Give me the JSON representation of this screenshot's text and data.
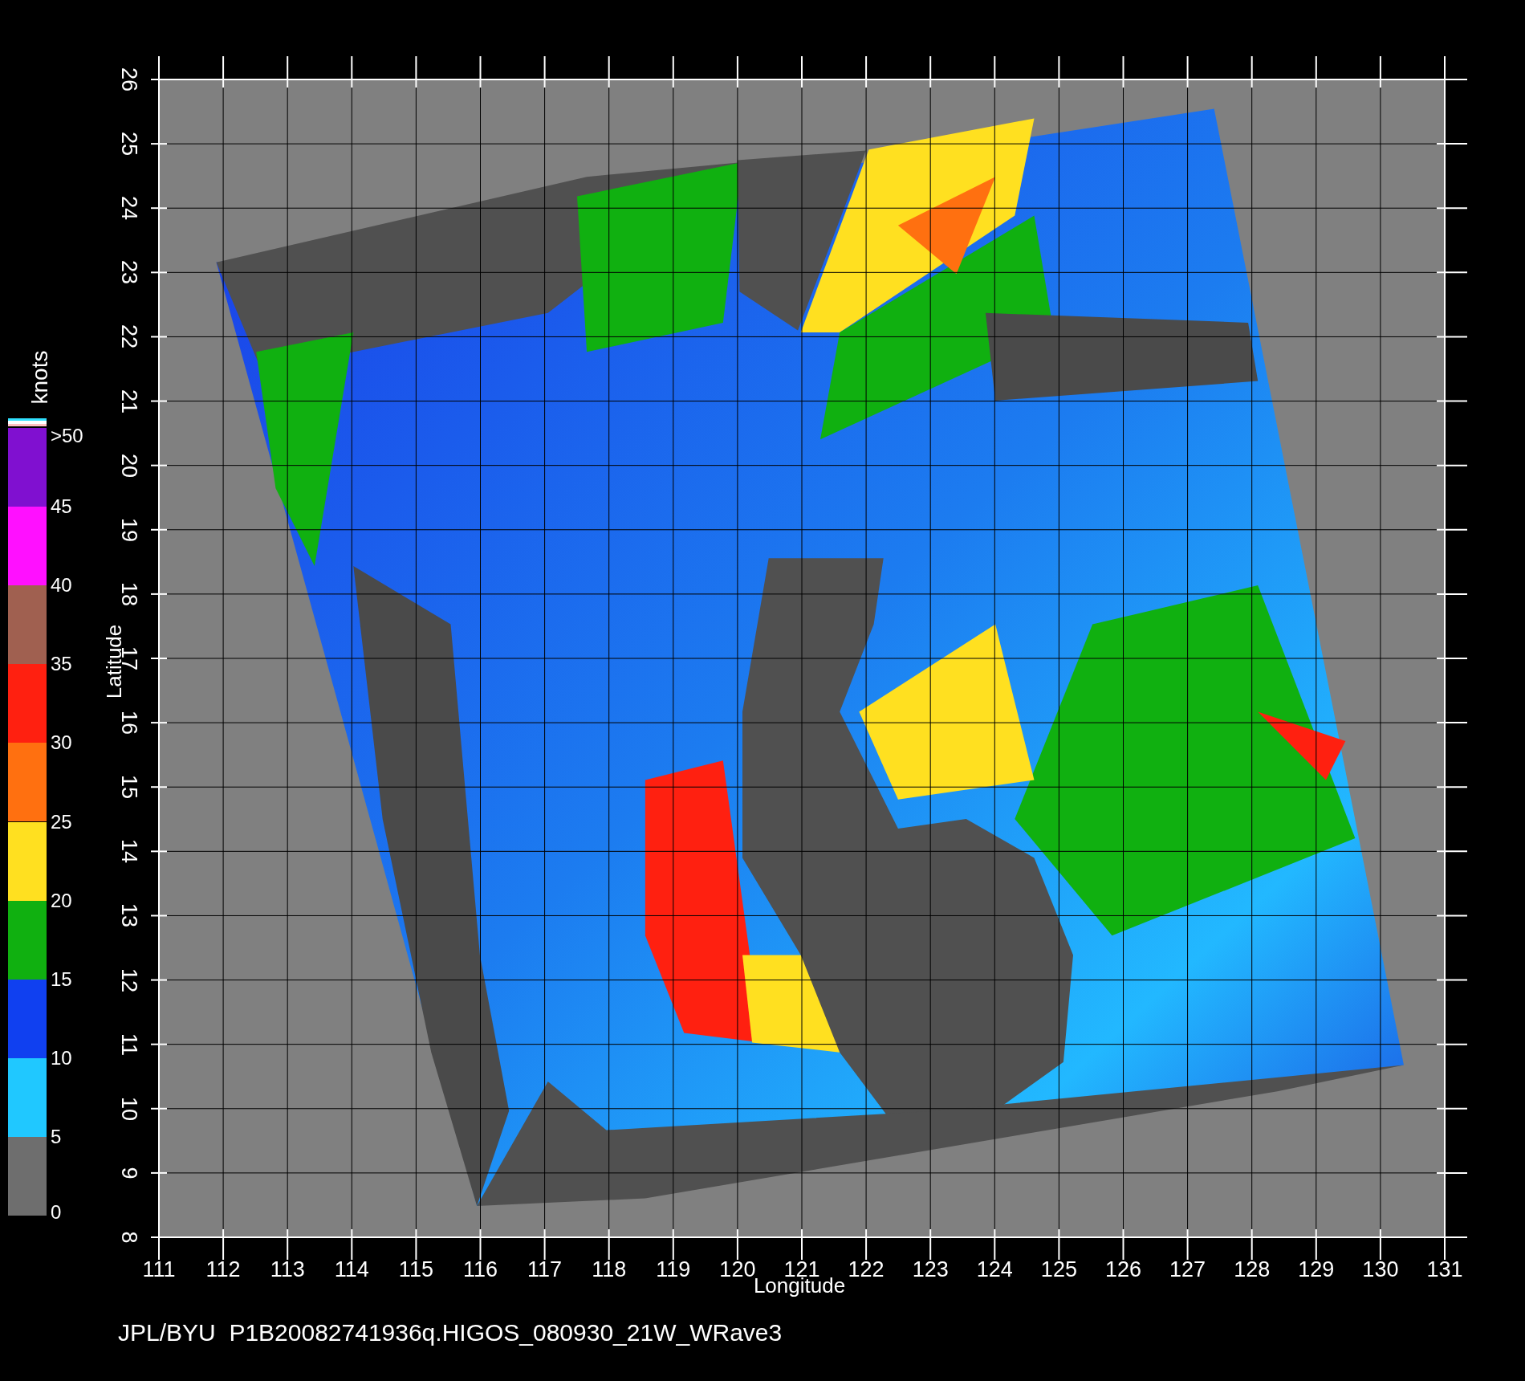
{
  "plot": {
    "xlabel": "Longitude",
    "ylabel": "Latitude",
    "xticks": [
      "111",
      "112",
      "113",
      "114",
      "115",
      "116",
      "117",
      "118",
      "119",
      "120",
      "121",
      "122",
      "123",
      "124",
      "125",
      "126",
      "127",
      "128",
      "129",
      "130",
      "131"
    ],
    "yticks": [
      "8",
      "9",
      "10",
      "11",
      "12",
      "13",
      "14",
      "15",
      "16",
      "17",
      "18",
      "19",
      "20",
      "21",
      "22",
      "23",
      "24",
      "25",
      "26"
    ]
  },
  "colorbar": {
    "title": "knots",
    "bands": [
      {
        "color": "#8010d0"
      },
      {
        "color": "#ff10ff"
      },
      {
        "color": "#a06050"
      },
      {
        "color": "#ff2010"
      },
      {
        "color": "#ff7010"
      },
      {
        "color": "#ffe020"
      },
      {
        "color": "#10b010"
      },
      {
        "color": "#1040f0"
      },
      {
        "color": "#20c8ff"
      },
      {
        "color": "#6e6e6e"
      }
    ],
    "labels": [
      ">50",
      "45",
      "40",
      "35",
      "30",
      "25",
      "20",
      "15",
      "10",
      "5",
      "0"
    ]
  },
  "caption": "JPL/BYU  P1B20082741936q.HIGOS_080930_21W_WRave3"
}
